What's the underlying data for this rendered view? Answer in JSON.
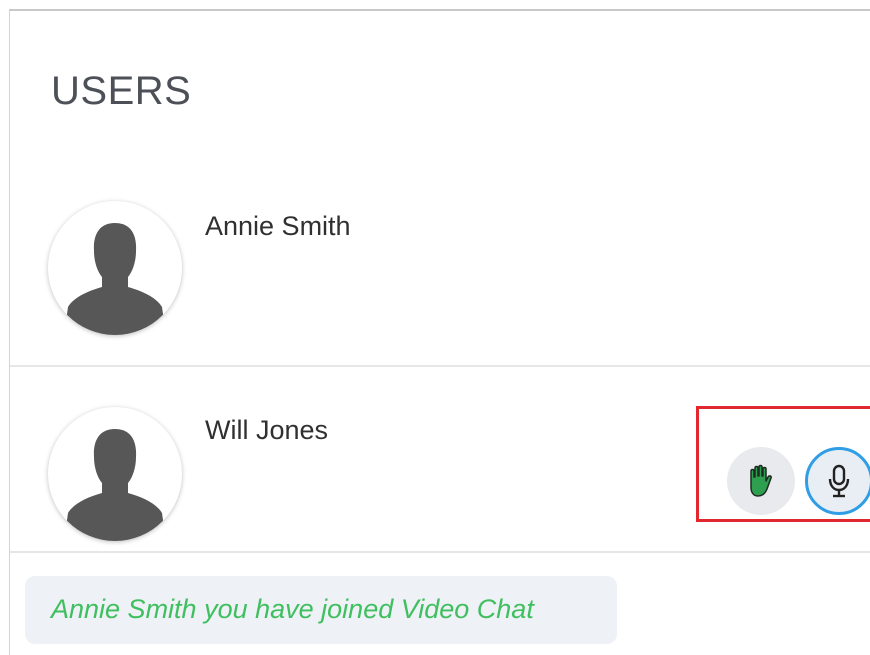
{
  "panel": {
    "title": "USERS"
  },
  "users": [
    {
      "name": "Annie Smith",
      "avatar_icon": "user-silhouette-icon"
    },
    {
      "name": "Will Jones",
      "avatar_icon": "user-silhouette-icon"
    }
  ],
  "controls": {
    "raise_hand_icon": "hand-icon",
    "raise_hand_color": "#2e9e4f",
    "mic_icon": "microphone-icon",
    "mic_border_color": "#2f9ee6",
    "highlight_color": "#e0282e"
  },
  "notification": {
    "text": "Annie Smith you have joined Video Chat",
    "color": "#3fbf5f"
  }
}
